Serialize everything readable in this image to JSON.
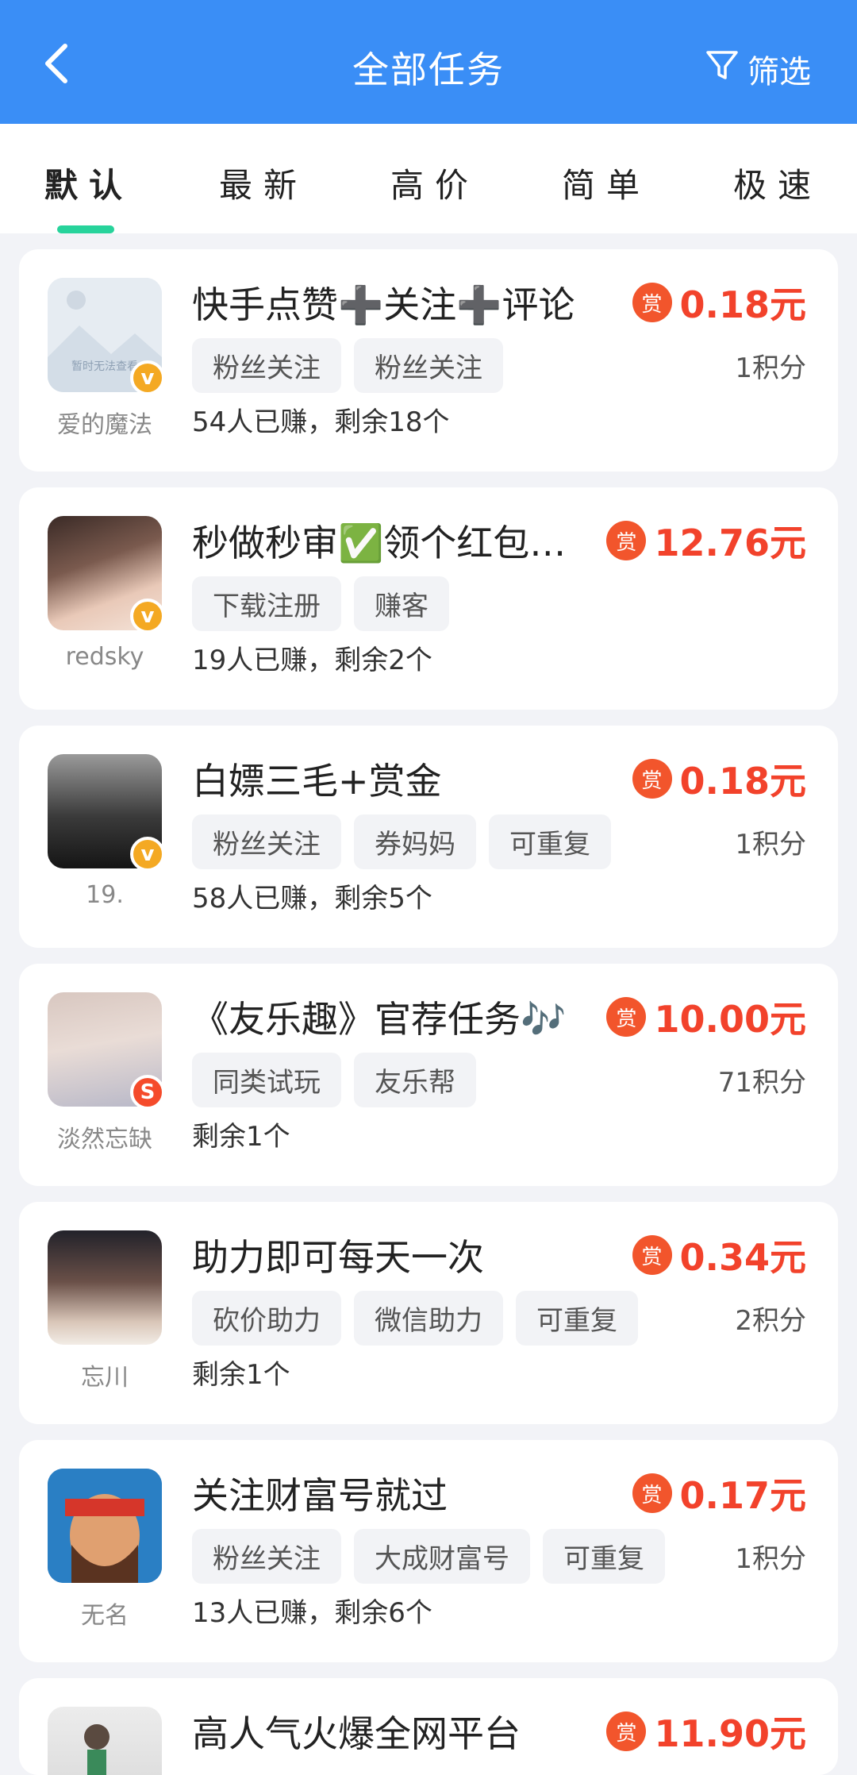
{
  "header": {
    "title": "全部任务",
    "filter_label": "筛选"
  },
  "tabs": [
    {
      "label": "默认"
    },
    {
      "label": "最新"
    },
    {
      "label": "高价"
    },
    {
      "label": "简单"
    },
    {
      "label": "极速"
    }
  ],
  "reward_badge": "赏",
  "tasks": [
    {
      "title": "快手点赞➕关注➕评论",
      "reward": "0.18元",
      "tags": [
        "粉丝关注",
        "粉丝关注"
      ],
      "points": "1积分",
      "stats": "54人已赚，剩余18个",
      "user": "爱的魔法",
      "avatar_text": "暂时无法查看",
      "badge": "v"
    },
    {
      "title": "秒做秒审✅领个红包就过",
      "reward": "12.76元",
      "tags": [
        "下载注册",
        "赚客"
      ],
      "points": "",
      "stats": "19人已赚，剩余2个",
      "user": "redsky",
      "badge": "v"
    },
    {
      "title": "白嫖三毛+赏金",
      "reward": "0.18元",
      "tags": [
        "粉丝关注",
        "券妈妈",
        "可重复"
      ],
      "points": "1积分",
      "stats": "58人已赚，剩余5个",
      "user": "19.",
      "badge": "v"
    },
    {
      "title": "《友乐趣》官荐任务🎶",
      "reward": "10.00元",
      "tags": [
        "同类试玩",
        "友乐帮"
      ],
      "points": "71积分",
      "stats": "剩余1个",
      "user": "淡然忘缺",
      "badge": "S"
    },
    {
      "title": "助力即可每天一次",
      "reward": "0.34元",
      "tags": [
        "砍价助力",
        "微信助力",
        "可重复"
      ],
      "points": "2积分",
      "stats": "剩余1个",
      "user": "忘川",
      "badge": ""
    },
    {
      "title": "关注财富号就过",
      "reward": "0.17元",
      "tags": [
        "粉丝关注",
        "大成财富号",
        "可重复"
      ],
      "points": "1积分",
      "stats": "13人已赚，剩余6个",
      "user": "无名",
      "badge": ""
    },
    {
      "title": "高人气火爆全网平台",
      "reward": "11.90元",
      "tags": [],
      "points": "",
      "stats": "",
      "user": "",
      "badge": ""
    }
  ]
}
